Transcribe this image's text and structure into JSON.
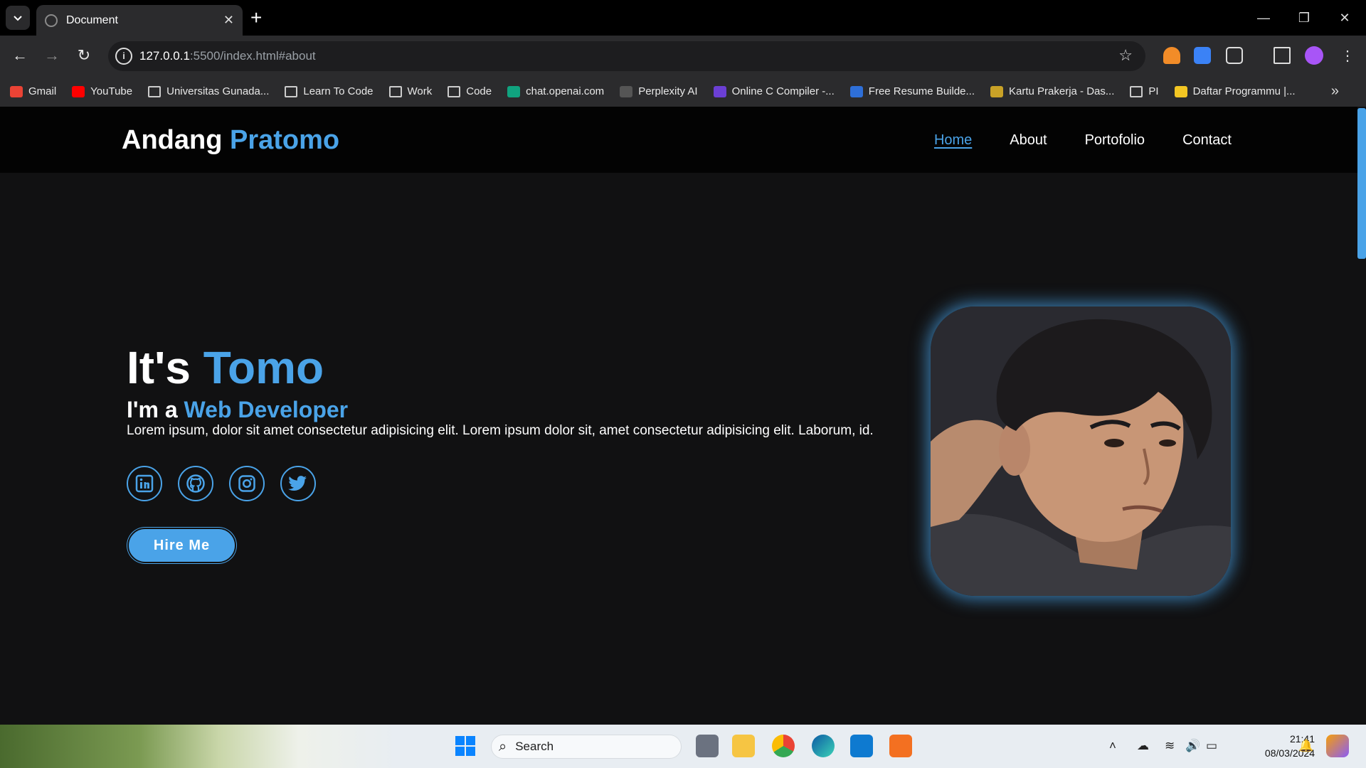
{
  "browser": {
    "tab_title": "Document",
    "url_host": "127.0.0.1",
    "url_rest": ":5500/index.html#about",
    "bookmarks": [
      {
        "label": "Gmail",
        "color": "#EA4335"
      },
      {
        "label": "YouTube",
        "color": "#FF0000"
      },
      {
        "label": "Universitas Gunada...",
        "folder": true
      },
      {
        "label": "Learn To Code",
        "folder": true
      },
      {
        "label": "Work",
        "folder": true
      },
      {
        "label": "Code",
        "folder": true
      },
      {
        "label": "chat.openai.com",
        "color": "#10A37F"
      },
      {
        "label": "Perplexity AI",
        "color": "#555555"
      },
      {
        "label": "Online C Compiler -...",
        "color": "#6B3FD4"
      },
      {
        "label": "Free Resume Builde...",
        "color": "#2E6FD8"
      },
      {
        "label": "Kartu Prakerja - Das...",
        "color": "#C9A227"
      },
      {
        "label": "PI",
        "folder": true
      },
      {
        "label": "Daftar Programmu |...",
        "color": "#F3C623"
      }
    ]
  },
  "site": {
    "logo_first": "Andang",
    "logo_second": "Pratomo",
    "nav": {
      "home": "Home",
      "about": "About",
      "portfolio": "Portofolio",
      "contact": "Contact"
    },
    "hero": {
      "title_prefix": "It's",
      "title_name": "Tomo",
      "sub_prefix": "I'm a",
      "sub_role": "Web Developer",
      "description": "Lorem ipsum, dolor sit amet consectetur adipisicing elit. Lorem ipsum dolor sit, amet consectetur adipisicing elit. Laborum, id.",
      "cta": "Hire Me"
    },
    "socials": [
      "linkedin-icon",
      "github-icon",
      "instagram-icon",
      "twitter-icon"
    ],
    "accent_color": "#4AA3E8"
  },
  "taskbar": {
    "search_label": "Search",
    "time": "21:41",
    "date": "08/03/2024"
  }
}
